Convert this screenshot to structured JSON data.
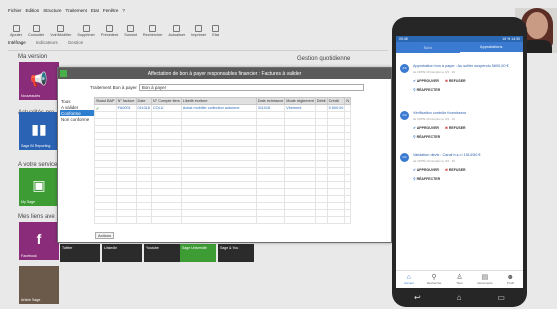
{
  "menubar": [
    "Fichier",
    "Edition",
    "Structure",
    "Traitement",
    "Etat",
    "Fenêtre",
    "?"
  ],
  "toolbar": [
    "Ajouter",
    "Consulter",
    "Voir/Modifier",
    "Supprimer",
    "Précédent",
    "Suivant",
    "Rechercher",
    "Actualiser",
    "Imprimer",
    "Etat"
  ],
  "tabs": [
    "Intéfrage",
    "Indicateurs",
    "Gestion"
  ],
  "left": {
    "ma_version": "Ma version",
    "tile1": "Nouveautés",
    "actualites": "Actualités pro",
    "tile2": "Sage BI Reporting",
    "votre_service": "A votre service",
    "tile3": "My Sage",
    "mes_liens": "Mes liens ave",
    "tile4": "Facebook",
    "tile5": "Article Sage"
  },
  "gestion_title": "Gestion quotidienne",
  "bottom_tiles": [
    "Twitter",
    "LinkedIn",
    "Youtube",
    "Sage Université",
    "Sage & You"
  ],
  "modal": {
    "title": "Affectation de bon à payer responsables financier : Factures à valider",
    "filter_label": "Traitement Bon à payer",
    "filter_value": "Bon à payer",
    "left_items": [
      "Tous",
      "A valider",
      "Conforme",
      "Non conforme"
    ],
    "columns": [
      "Statut BAP",
      "N° facture",
      "Date",
      "N° Compte tiers",
      "Libellé écriture",
      "Date échéance",
      "Mode règlement",
      "Débit",
      "Crédit",
      "N"
    ],
    "rows": [
      [
        "✔",
        "FA0001",
        "011018",
        "COLU",
        "Achat mobilier collection automne",
        "311018",
        "Virement",
        "",
        "5 600,00",
        ""
      ]
    ],
    "actions": "Actions"
  },
  "phone": {
    "status_left": "09:48",
    "status_right": "16 % 14:30",
    "tabs": [
      "Suivi",
      "Approbations"
    ],
    "cards": [
      {
        "initial": "AS",
        "title": "Approbation bon à payer : Au sollier suspendu 5600,00 €",
        "sub": "de OPPE Christophe le 4/3 · 16"
      },
      {
        "initial": "OC",
        "title": "Vérification contrôle fournisseur",
        "sub": "de OPPE Christophe le 4/3 · 16"
      },
      {
        "initial": "OC",
        "title": "Validation devis : Canal b.s.r.l 1514/50 €",
        "sub": "de OPPE Christophe le 4/3 · 16"
      }
    ],
    "approve": "APPROUVER",
    "reject": "REFUSER",
    "reassign": "RÉAFFECTER",
    "nav": [
      "Accueil",
      "Recherche",
      "Tiers",
      "Documents",
      "Profil"
    ]
  }
}
